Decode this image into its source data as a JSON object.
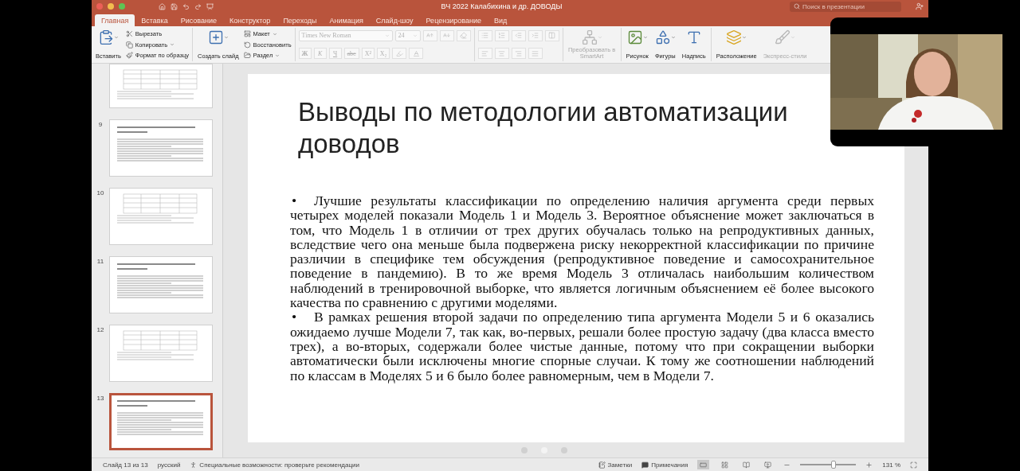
{
  "window": {
    "title": "ВЧ 2022 Калабихина и др. ДОВОДЫ"
  },
  "search": {
    "placeholder": "Поиск в презентации"
  },
  "tabs": [
    {
      "label": "Главная",
      "selected": true
    },
    {
      "label": "Вставка",
      "selected": false
    },
    {
      "label": "Рисование",
      "selected": false
    },
    {
      "label": "Конструктор",
      "selected": false
    },
    {
      "label": "Переходы",
      "selected": false
    },
    {
      "label": "Анимация",
      "selected": false
    },
    {
      "label": "Слайд-шоу",
      "selected": false
    },
    {
      "label": "Рецензирование",
      "selected": false
    },
    {
      "label": "Вид",
      "selected": false
    }
  ],
  "ribbon": {
    "clipboard": {
      "main": {
        "label": "Вставить",
        "kind": "paste",
        "dropdown": true
      },
      "items": [
        {
          "label": "Вырезать",
          "kind": "cut",
          "dropdown": false
        },
        {
          "label": "Копировать",
          "kind": "copy",
          "dropdown": true
        },
        {
          "label": "Формат по образцу",
          "kind": "painter",
          "dropdown": false
        }
      ]
    },
    "slides": {
      "main": {
        "label": "Создать слайд",
        "kind": "new-slide",
        "dropdown": true
      },
      "items": [
        {
          "label": "Макет",
          "kind": "layout",
          "dropdown": true
        },
        {
          "label": "Восстановить",
          "kind": "reset",
          "dropdown": false
        },
        {
          "label": "Раздел",
          "kind": "section",
          "dropdown": true
        }
      ]
    },
    "font": {
      "name": "Times New Roman",
      "size": "24",
      "disabled": true,
      "styles": [
        "Ж",
        "К",
        "Ч",
        "abc",
        "X²",
        "X₂"
      ]
    },
    "paragraph": {
      "disabled": true
    },
    "tools": [
      [
        {
          "label": "Преобразовать в SmartArt",
          "kind": "smartart",
          "disabled": true,
          "dropdown": true
        }
      ],
      [
        {
          "label": "Рисунок",
          "kind": "picture",
          "disabled": false,
          "dropdown": true
        },
        {
          "label": "Фигуры",
          "kind": "shapes",
          "disabled": false,
          "dropdown": true
        },
        {
          "label": "Надпись",
          "kind": "textbox",
          "disabled": false,
          "dropdown": false
        }
      ],
      [
        {
          "label": "Расположение",
          "kind": "arrange",
          "disabled": false,
          "dropdown": true
        },
        {
          "label": "Экспресс-стили",
          "kind": "quick-styles",
          "disabled": true,
          "dropdown": true
        }
      ]
    ]
  },
  "thumbnails": [
    {
      "selected": false,
      "kind": "table"
    },
    {
      "number": "9",
      "selected": false,
      "kind": "text"
    },
    {
      "number": "10",
      "selected": false,
      "kind": "table"
    },
    {
      "number": "11",
      "selected": false,
      "kind": "text"
    },
    {
      "number": "12",
      "selected": false,
      "kind": "table"
    },
    {
      "number": "13",
      "selected": true,
      "kind": "text"
    }
  ],
  "slide": {
    "title": "Выводы по методологии автоматизации доводов",
    "bullets": [
      {
        "marker": "•",
        "text": "Лучшие результаты классификации по определению наличия аргумента среди первых четырех моделей показали Модель 1 и Модель 3. Вероятное объяснение может заключаться в том, что Модель 1 в отличии от трех других обучалась только на репродуктивных данных, вследствие чего она меньше была подвержена риску некорректной классификации по причине различии в специфике тем обсуждения (репродуктивное поведение и самосохранительное поведение в пандемию). В то же время Модель 3 отличалась наибольшим количеством наблюдений в тренировочной выборке, что является логичным объяснением её более высокого качества по сравнению с другими моделями."
      },
      {
        "marker": "•",
        "text": "В рамках решения второй задачи по определению типа аргумента Модели 5 и 6 оказались ожидаемо лучше Модели 7, так как, во-первых, решали более простую задачу (два класса вместо трех), а во-вторых, содержали более чистые данные, потому что при сокращении выборки автоматически были исключены многие спорные случаи. К тому же соотношении наблюдений по классам в Моделях 5 и 6 было более равномерным, чем в Модели 7."
      }
    ]
  },
  "pager": [
    {
      "selected": false
    },
    {
      "selected": true
    },
    {
      "selected": false
    }
  ],
  "status_bar": {
    "slide": "Слайд 13 из 13",
    "language": "русский",
    "accessibility": "Специальные возможности: проверьте рекомендации",
    "notes": "Заметки",
    "comments": "Примечания",
    "views": [
      {
        "kind": "normal",
        "selected": true
      },
      {
        "kind": "sorter",
        "selected": false
      },
      {
        "kind": "reading",
        "selected": false
      },
      {
        "kind": "slideshow",
        "selected": false
      }
    ],
    "zoom": {
      "level": 0.6,
      "reading": "131 %"
    }
  }
}
